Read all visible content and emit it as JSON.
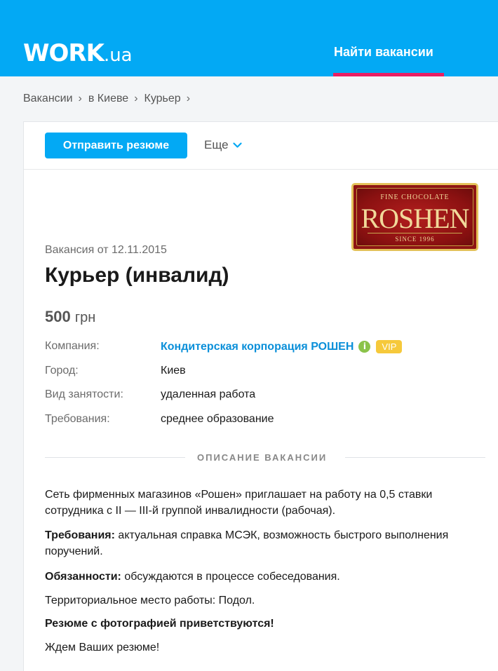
{
  "header": {
    "logo_main": "WORK",
    "logo_suffix": ".ua",
    "nav_find": "Найти вакансии",
    "colors": {
      "header_bg": "#03a9f4",
      "nav_underline": "#e91e63"
    }
  },
  "breadcrumb": {
    "items": [
      "Вакансии",
      "в Киеве",
      "Курьер"
    ],
    "separator": "›"
  },
  "toolbar": {
    "send_resume_label": "Отправить резюме",
    "more_label": "Еще"
  },
  "company_logo": {
    "fine": "FINE CHOCOLATE",
    "brand": "ROSHEN",
    "since": "SINCE 1996"
  },
  "vacancy": {
    "posted": "Вакансия от 12.11.2015",
    "title": "Курьер (инвалид)",
    "salary_amount": "500",
    "salary_currency": "грн",
    "details": [
      {
        "label": "Компания:",
        "value": "Кондитерская корпорация РОШЕН"
      },
      {
        "label": "Город:",
        "value": "Киев"
      },
      {
        "label": "Вид занятости:",
        "value": "удаленная работа"
      },
      {
        "label": "Требования:",
        "value": "среднее образование"
      }
    ],
    "company_info_icon": "i",
    "company_badge": "VIP"
  },
  "description": {
    "section_title": "ОПИСАНИЕ ВАКАНСИИ",
    "intro": "Сеть фирменных магазинов «Рошен» приглашает на работу на 0,5 ставки сотрудника с II — III-й группой инвалидности (рабочая).",
    "req_label": "Требования:",
    "req_text": " актуальная справка МСЭК, возможность быстрого выполнения поручений.",
    "duty_label": "Обязанности:",
    "duty_text": " обсуждаются в процессе собеседования.",
    "location": "Территориальное место работы: Подол.",
    "photo_note": "Резюме с фотографией приветствуются!",
    "closing": "Ждем Ваших резюме!"
  }
}
